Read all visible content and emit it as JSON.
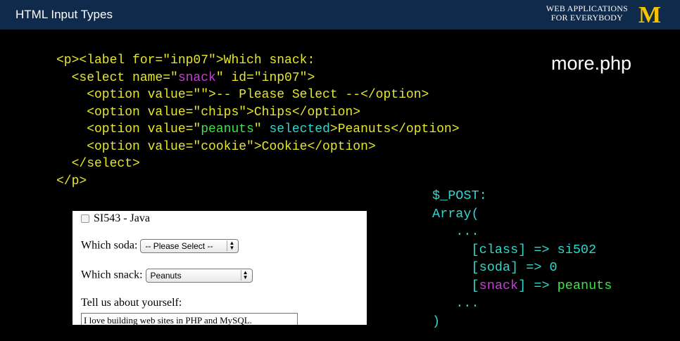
{
  "header": {
    "title": "HTML Input Types",
    "brand_line1": "WEB APPLICATIONS",
    "brand_line2": "FOR EVERYBODY",
    "logo_letter": "M"
  },
  "filename": "more.php",
  "code_lines": [
    [
      {
        "t": "<p><label for=\"inp07\">Which snack:",
        "c": "y"
      }
    ],
    [
      {
        "t": "  <select name=\"",
        "c": "y"
      },
      {
        "t": "snack",
        "c": "m"
      },
      {
        "t": "\" id=\"inp07\">",
        "c": "y"
      }
    ],
    [
      {
        "t": "    <option value=\"\">-- Please Select --</option>",
        "c": "y"
      }
    ],
    [
      {
        "t": "    <option value=\"chips\">Chips</option>",
        "c": "y"
      }
    ],
    [
      {
        "t": "    <option value=\"",
        "c": "y"
      },
      {
        "t": "peanuts",
        "c": "g"
      },
      {
        "t": "\" ",
        "c": "y"
      },
      {
        "t": "selected",
        "c": "c"
      },
      {
        "t": ">Peanuts</option>",
        "c": "y"
      }
    ],
    [
      {
        "t": "    <option value=\"cookie\">Cookie</option>",
        "c": "y"
      }
    ],
    [
      {
        "t": "  </select>",
        "c": "y"
      }
    ],
    [
      {
        "t": "</p>",
        "c": "y"
      }
    ]
  ],
  "post_lines": [
    [
      {
        "t": "$_POST:",
        "c": "c"
      }
    ],
    [
      {
        "t": "Array(",
        "c": "c"
      }
    ],
    [
      {
        "t": "   ...",
        "c": "c"
      }
    ],
    [
      {
        "t": "     [class] => si502",
        "c": "c"
      }
    ],
    [
      {
        "t": "     [soda] => 0",
        "c": "c"
      }
    ],
    [
      {
        "t": "     [",
        "c": "c"
      },
      {
        "t": "snack",
        "c": "m"
      },
      {
        "t": "] => ",
        "c": "c"
      },
      {
        "t": "peanuts",
        "c": "g"
      }
    ],
    [
      {
        "t": "   ...",
        "c": "c"
      }
    ],
    [
      {
        "t": ")",
        "c": "c"
      }
    ]
  ],
  "form": {
    "checkbox_label": "SI543 - Java",
    "soda_label": "Which soda:",
    "soda_value": "-- Please Select --",
    "snack_label": "Which snack:",
    "snack_value": "Peanuts",
    "about_label": "Tell us about yourself:",
    "about_value": "I love building web sites in PHP and MySQL."
  }
}
